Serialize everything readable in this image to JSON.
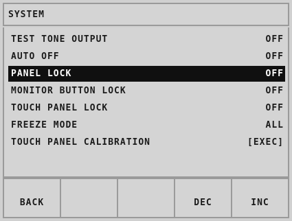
{
  "title": "SYSTEM",
  "menu": {
    "items": [
      {
        "label": "TEST TONE OUTPUT",
        "value": "OFF",
        "selected": false
      },
      {
        "label": "AUTO OFF",
        "value": "OFF",
        "selected": false
      },
      {
        "label": "PANEL LOCK",
        "value": "OFF",
        "selected": true
      },
      {
        "label": "MONITOR BUTTON LOCK",
        "value": "OFF",
        "selected": false
      },
      {
        "label": "TOUCH PANEL LOCK",
        "value": "OFF",
        "selected": false
      },
      {
        "label": "FREEZE MODE",
        "value": "ALL",
        "selected": false
      },
      {
        "label": "TOUCH PANEL CALIBRATION",
        "value": "[EXEC]",
        "selected": false
      }
    ]
  },
  "buttons": {
    "b1": "BACK",
    "b2": "",
    "b3": "",
    "b4": "DEC",
    "b5": "INC"
  },
  "colors": {
    "background": "#d4d4d4",
    "border": "#9a9a9a",
    "selected_bg": "#101010",
    "selected_fg": "#ffffff",
    "text": "#1a1a1a"
  }
}
